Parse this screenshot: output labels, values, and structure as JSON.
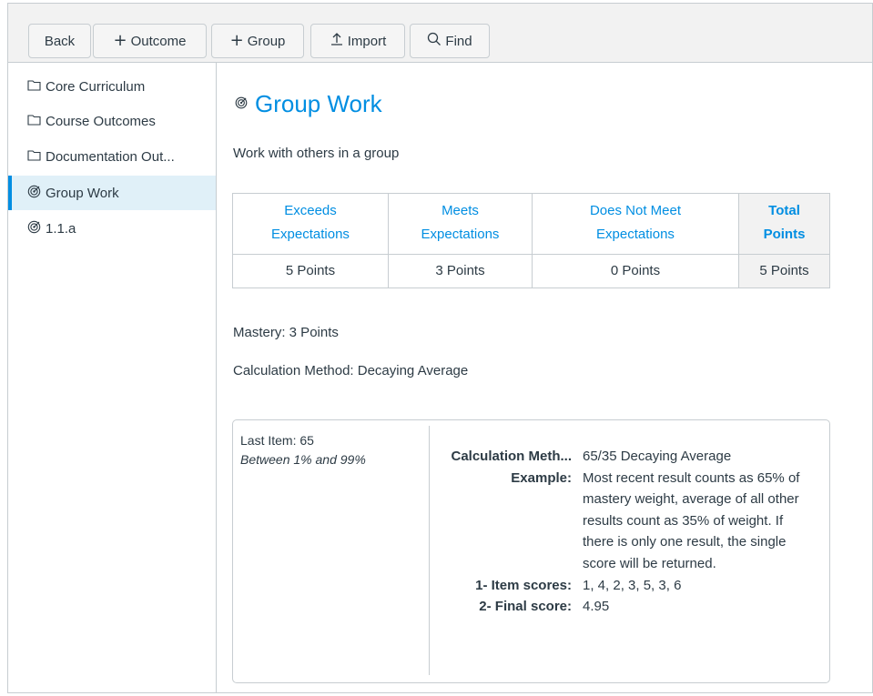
{
  "toolbar": {
    "back": "Back",
    "outcome": "Outcome",
    "group": "Group",
    "import": "Import",
    "find": "Find"
  },
  "sidebar": {
    "items": [
      {
        "label": "Core Curriculum",
        "icon": "folder-icon"
      },
      {
        "label": "Course Outcomes",
        "icon": "folder-icon"
      },
      {
        "label": "Documentation Out...",
        "icon": "folder-icon"
      },
      {
        "label": "Group Work",
        "icon": "outcome-target-icon"
      },
      {
        "label": "1.1.a",
        "icon": "outcome-target-icon"
      }
    ]
  },
  "main": {
    "title": "Group Work",
    "description": "Work with others in a group",
    "rubric": {
      "columns": [
        {
          "line1": "Exceeds",
          "line2": "Expectations",
          "points": "5 Points"
        },
        {
          "line1": "Meets",
          "line2": "Expectations",
          "points": "3 Points"
        },
        {
          "line1": "Does Not Meet",
          "line2": "Expectations",
          "points": "0 Points"
        },
        {
          "line1": "Total",
          "line2": "Points",
          "points": "5 Points"
        }
      ]
    },
    "mastery": "Mastery: 3 Points",
    "calculation_method": "Calculation Method: Decaying Average",
    "calc_box": {
      "last_item": "Last Item: 65",
      "range": "Between 1% and 99%",
      "rows": [
        {
          "key": "Calculation Meth...",
          "value": "65/35 Decaying Average"
        },
        {
          "key": "Example:",
          "value": "Most recent result counts as 65% of mastery weight, average of all other results count as 35% of weight. If there is only one result, the single score will be returned."
        },
        {
          "key": "1- Item scores:",
          "value": "1, 4, 2, 3, 5, 3, 6"
        },
        {
          "key": "2- Final score:",
          "value": "4.95"
        }
      ]
    }
  },
  "colors": {
    "accent": "#008ee2",
    "active_bg": "#e0f0f8",
    "border": "#c7cdd1",
    "toolbar_bg": "#f2f2f2"
  }
}
